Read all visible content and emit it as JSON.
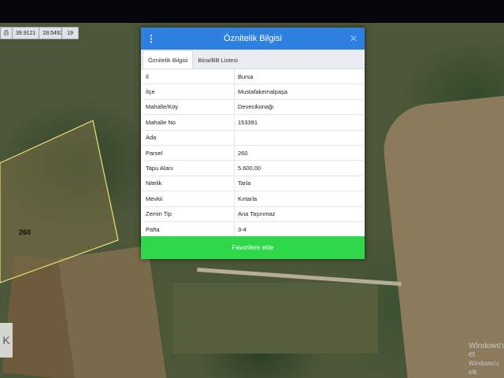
{
  "coords": {
    "lat": "39.9121",
    "lon": "28.5492",
    "zoom": "19"
  },
  "map": {
    "parcel_label": "260"
  },
  "dialog": {
    "title": "Öznitelik Bilgisi",
    "tabs": [
      "Öznitelik Bilgisi",
      "Bina/BB Listesi"
    ],
    "rows": [
      {
        "key": "İl",
        "value": "Bursa"
      },
      {
        "key": "İlçe",
        "value": "Mustafakemalpaşa"
      },
      {
        "key": "Mahalle/Köy",
        "value": "Devecikonağı"
      },
      {
        "key": "Mahalle No",
        "value": "153391"
      },
      {
        "key": "Ada",
        "value": ""
      },
      {
        "key": "Parsel",
        "value": "260"
      },
      {
        "key": "Tapu Alanı",
        "value": "5.600,00"
      },
      {
        "key": "Nitelik",
        "value": "Tarla"
      },
      {
        "key": "Mevkii",
        "value": "Kırtarla"
      },
      {
        "key": "Zemin Tip",
        "value": "Ana Taşınmaz"
      },
      {
        "key": "Pafta",
        "value": "3-4"
      }
    ],
    "favorite_button": "Favorilere ekle"
  },
  "watermark": {
    "line1": "Windows'u et",
    "line2": "Windows'u etk"
  },
  "colors": {
    "header": "#2d7fe0",
    "favorite": "#2fd84b"
  }
}
